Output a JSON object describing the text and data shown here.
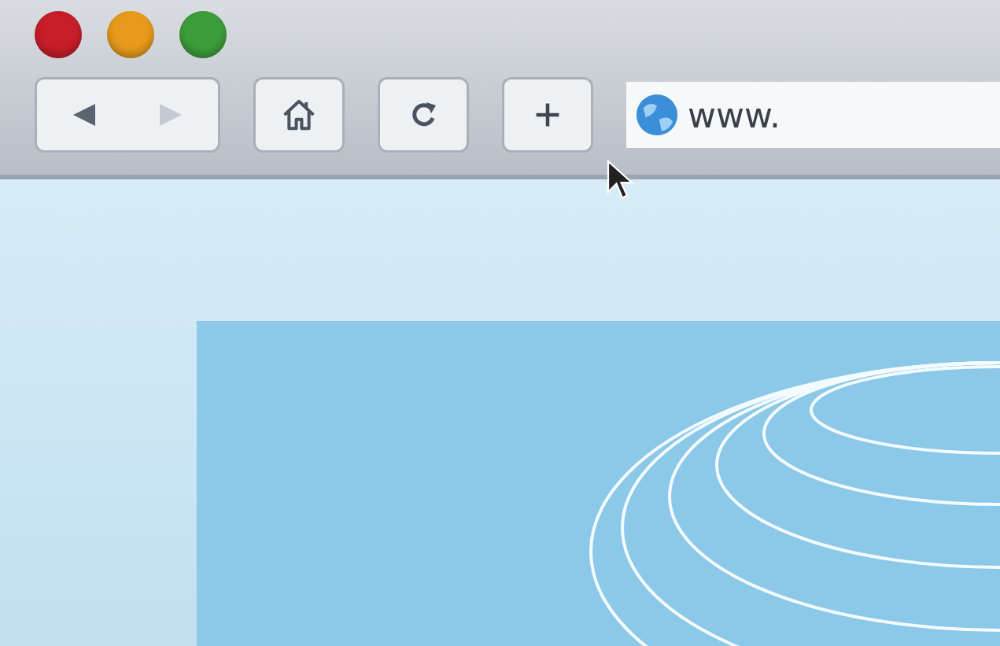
{
  "window_controls": [
    {
      "color": "#c81e2a"
    },
    {
      "color": "#e89a1c"
    },
    {
      "color": "#3c9e3a"
    }
  ],
  "toolbar": {
    "nav": [
      {
        "kind": "back",
        "disabled": false
      },
      {
        "kind": "forward",
        "disabled": true
      }
    ],
    "buttons": [
      {
        "kind": "home"
      },
      {
        "kind": "reload"
      },
      {
        "kind": "new-tab"
      }
    ],
    "address_bar": {
      "value": "www."
    }
  }
}
